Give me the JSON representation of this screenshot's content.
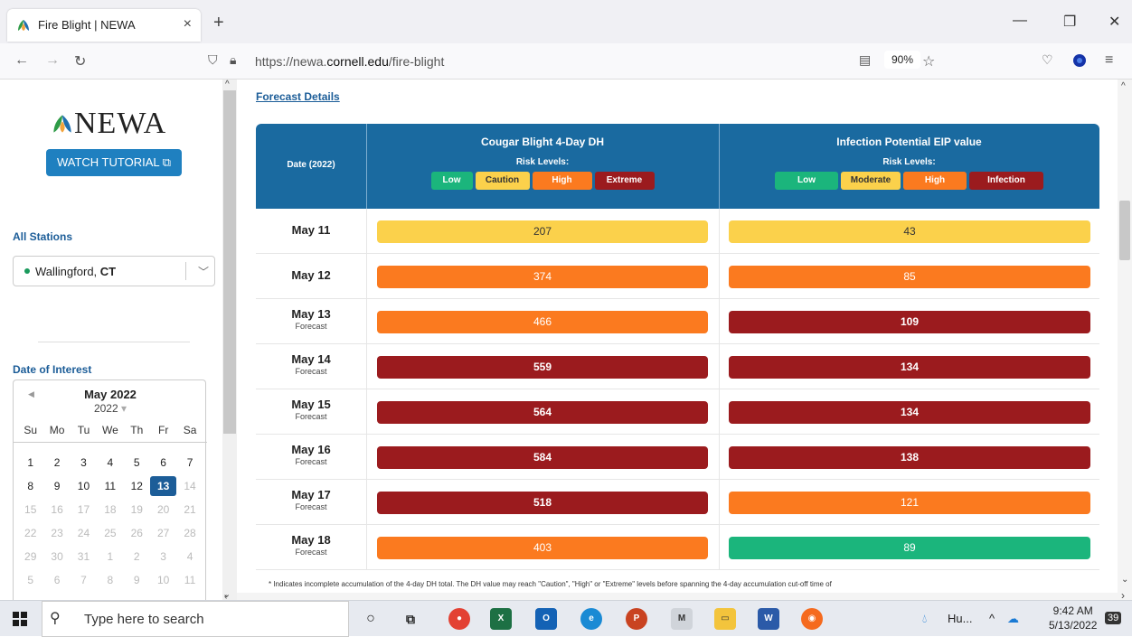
{
  "browser": {
    "tab_title": "Fire Blight | NEWA",
    "tab_close": "×",
    "new_tab": "+",
    "url_prefix": "https://newa.",
    "url_domain": "cornell.edu",
    "url_path": "/fire-blight",
    "zoom": "90%"
  },
  "sidebar": {
    "logo_text": "NEWA",
    "watch_tutorial": "WATCH TUTORIAL",
    "all_stations_label": "All Stations",
    "station_prefix": "Wallingford,",
    "station_state": "CT",
    "date_label": "Date of Interest",
    "calendar": {
      "month": "May 2022",
      "year": "2022",
      "weekdays": [
        "Su",
        "Mo",
        "Tu",
        "We",
        "Th",
        "Fr",
        "Sa"
      ],
      "weeks": [
        [
          "1",
          "2",
          "3",
          "4",
          "5",
          "6",
          "7"
        ],
        [
          "8",
          "9",
          "10",
          "11",
          "12",
          "13",
          "14"
        ],
        [
          "15",
          "16",
          "17",
          "18",
          "19",
          "20",
          "21"
        ],
        [
          "22",
          "23",
          "24",
          "25",
          "26",
          "27",
          "28"
        ],
        [
          "29",
          "30",
          "31",
          "1",
          "2",
          "3",
          "4"
        ],
        [
          "5",
          "6",
          "7",
          "8",
          "9",
          "10",
          "11"
        ]
      ],
      "selected_day": "13"
    }
  },
  "main": {
    "forecast_details": "Forecast Details",
    "date_header": "Date (2022)",
    "cougar_title": "Cougar Blight 4-Day DH",
    "eip_title": "Infection Potential EIP value",
    "risk_levels": "Risk Levels:",
    "cougar_levels": [
      "Low",
      "Caution",
      "High",
      "Extreme"
    ],
    "eip_levels": [
      "Low",
      "Moderate",
      "High",
      "Infection"
    ],
    "colors": {
      "low": "#1bb57c",
      "caution": "#fbd14b",
      "high": "#fb7a1f",
      "extreme": "#9b1b1e"
    },
    "rows": [
      {
        "date": "May 11",
        "forecast": "",
        "dh": "207",
        "dh_level": "caution",
        "eip": "43",
        "eip_level": "caution"
      },
      {
        "date": "May 12",
        "forecast": "",
        "dh": "374",
        "dh_level": "high",
        "eip": "85",
        "eip_level": "high"
      },
      {
        "date": "May 13",
        "forecast": "Forecast",
        "dh": "466",
        "dh_level": "high",
        "eip": "109",
        "eip_level": "extreme"
      },
      {
        "date": "May 14",
        "forecast": "Forecast",
        "dh": "559",
        "dh_level": "extreme",
        "eip": "134",
        "eip_level": "extreme"
      },
      {
        "date": "May 15",
        "forecast": "Forecast",
        "dh": "564",
        "dh_level": "extreme",
        "eip": "134",
        "eip_level": "extreme"
      },
      {
        "date": "May 16",
        "forecast": "Forecast",
        "dh": "584",
        "dh_level": "extreme",
        "eip": "138",
        "eip_level": "extreme"
      },
      {
        "date": "May 17",
        "forecast": "Forecast",
        "dh": "518",
        "dh_level": "extreme",
        "eip": "121",
        "eip_level": "high"
      },
      {
        "date": "May 18",
        "forecast": "Forecast",
        "dh": "403",
        "dh_level": "high",
        "eip": "89",
        "eip_level": "low"
      }
    ],
    "footnote": "* Indicates incomplete accumulation of the 4-day DH total. The DH value may reach \"Caution\", \"High\" or \"Extreme\" levels before spanning the 4-day accumulation cut-off time of"
  },
  "taskbar": {
    "search_placeholder": "Type here to search",
    "weather": "Hu...",
    "time": "9:42 AM",
    "date": "5/13/2022",
    "notifications": "39"
  }
}
